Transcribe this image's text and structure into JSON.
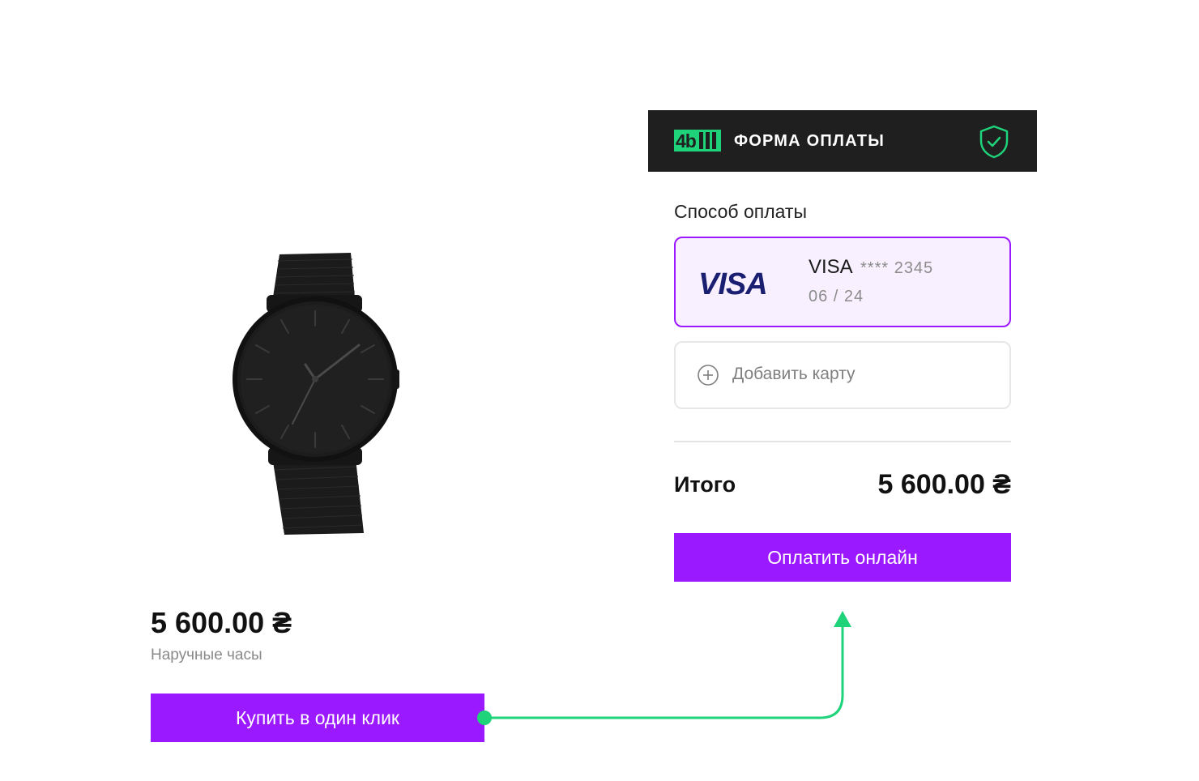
{
  "product": {
    "price": "5 600.00 ₴",
    "name": "Наручные часы",
    "buy_button_label": "Купить в один клик"
  },
  "payment_form": {
    "logo_text": "4bill",
    "title": "ФОРМА ОПЛАТЫ",
    "method_label": "Способ оплаты",
    "card": {
      "logo": "VISA",
      "brand": "VISA",
      "masked_number": "**** 2345",
      "expiry": "06 / 24"
    },
    "add_card_label": "Добавить карту",
    "total_label": "Итого",
    "total_value": "5 600.00 ₴",
    "pay_button_label": "Оплатить онлайн"
  },
  "colors": {
    "accent": "#9b19ff",
    "brand_green": "#1ed37a",
    "header_bg": "#1f1f1f",
    "visa_blue": "#1a1f71"
  },
  "icons": [
    "shield-check-icon",
    "plus-circle-icon",
    "arrow-connector-icon"
  ]
}
